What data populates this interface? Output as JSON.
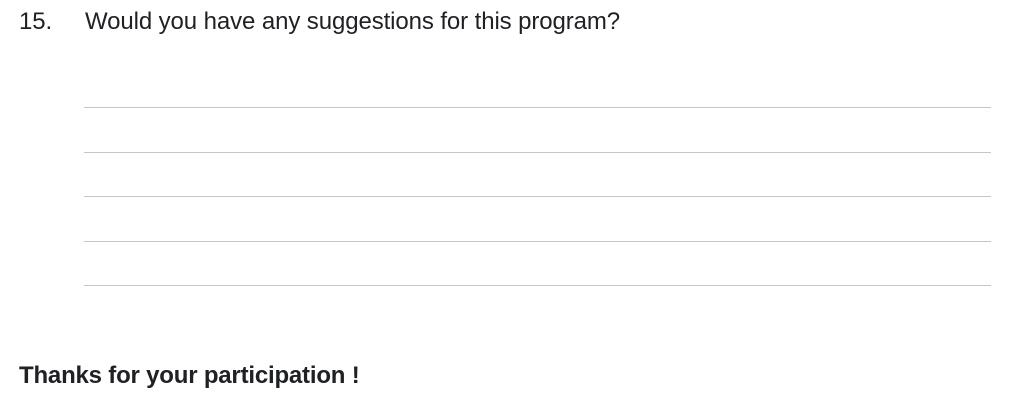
{
  "question": {
    "number": "15.",
    "text": "Would you have any suggestions for this program?"
  },
  "answer_lines": 5,
  "closing": {
    "text": "Thanks for your participation !"
  }
}
